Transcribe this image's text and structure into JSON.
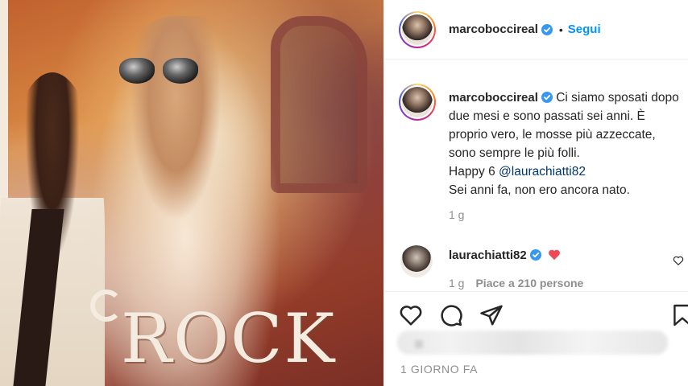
{
  "post": {
    "author": "marcoboccireal",
    "follow_label": "Segui",
    "separator": "•",
    "photo_text": "ROCK"
  },
  "caption": {
    "author": "marcoboccireal",
    "text_before": "Ci siamo sposati dopo due mesi e sono passati sei anni. È proprio vero, le mosse più azzeccate, sono sempre le più folli.",
    "text_happy": "Happy 6 ",
    "mention": "@laurachiatti82",
    "text_after": "Sei anni fa, non ero ancora nato.",
    "time_ago": "1 g"
  },
  "comment": {
    "author": "laurachiatti82",
    "emoji": "❤️",
    "time": "1 g",
    "likes": "Piace a 210 persone"
  },
  "footer": {
    "date": "1 GIORNO FA"
  },
  "colors": {
    "accent_blue": "#0095f6",
    "mention_blue": "#00376b",
    "verified_blue": "#3897f0",
    "heart_red": "#ed4956",
    "muted_gray": "#8e8e8e"
  },
  "icons": [
    "verified-badge-icon",
    "heart-icon",
    "comment-icon",
    "share-icon",
    "bookmark-icon",
    "comment-like-heart-icon",
    "red-heart-emoji-icon"
  ]
}
